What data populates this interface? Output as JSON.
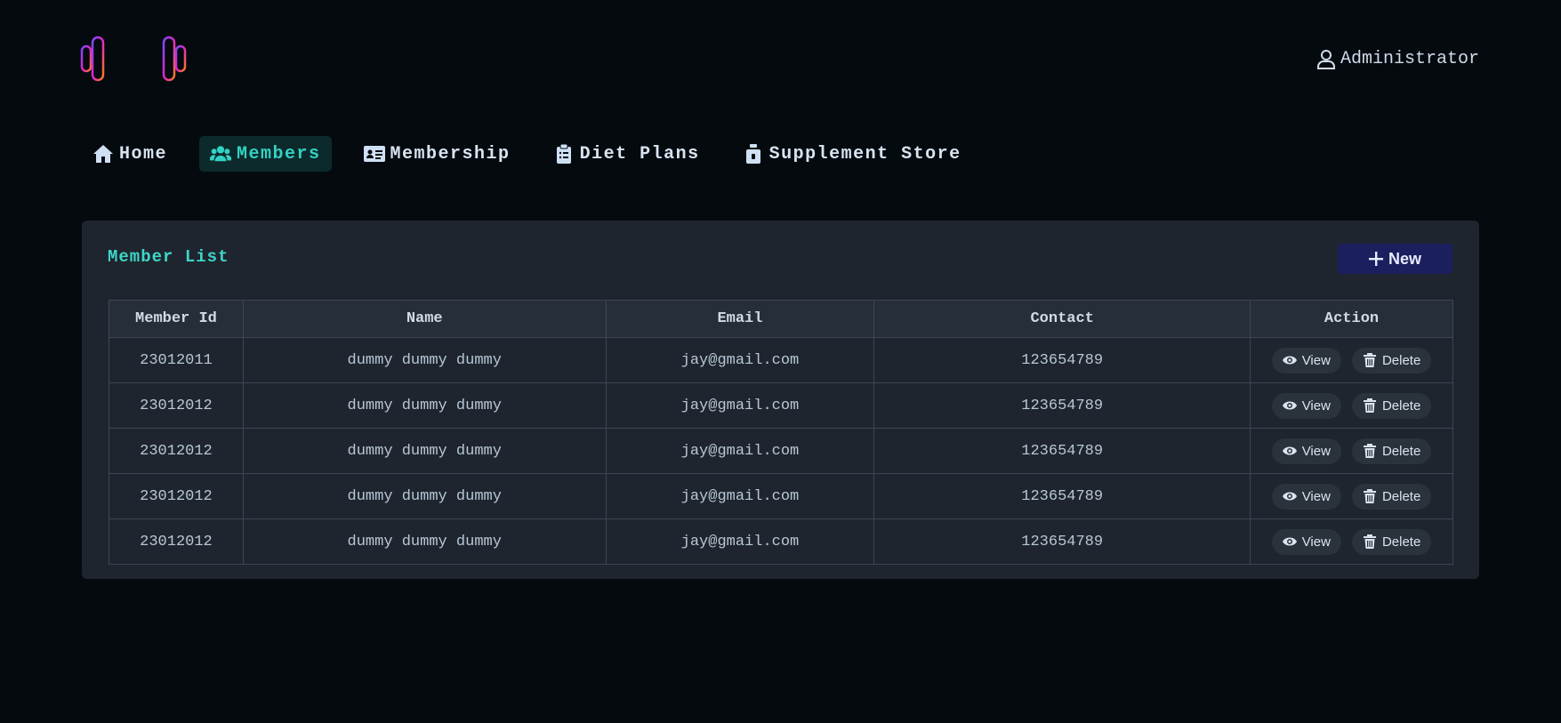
{
  "header": {
    "logo_icon": "dumbbell-icon",
    "user_icon": "user-icon",
    "user_name": "Administrator"
  },
  "nav": {
    "items": [
      {
        "label": "Home",
        "icon": "home-icon",
        "active": false
      },
      {
        "label": "Members",
        "icon": "users-icon",
        "active": true
      },
      {
        "label": "Membership",
        "icon": "id-card-icon",
        "active": false
      },
      {
        "label": "Diet Plans",
        "icon": "clipboard-list-icon",
        "active": false
      },
      {
        "label": "Supplement Store",
        "icon": "bottle-icon",
        "active": false
      }
    ]
  },
  "card": {
    "title": "Member List",
    "new_button_label": "New",
    "new_button_icon": "plus-icon"
  },
  "table": {
    "columns": [
      "Member Id",
      "Name",
      "Email",
      "Contact",
      "Action"
    ],
    "rows": [
      {
        "id": "23012011",
        "name": "dummy dummy dummy",
        "email": "jay@gmail.com",
        "contact": "123654789"
      },
      {
        "id": "23012012",
        "name": "dummy dummy dummy",
        "email": "jay@gmail.com",
        "contact": "123654789"
      },
      {
        "id": "23012012",
        "name": "dummy dummy dummy",
        "email": "jay@gmail.com",
        "contact": "123654789"
      },
      {
        "id": "23012012",
        "name": "dummy dummy dummy",
        "email": "jay@gmail.com",
        "contact": "123654789"
      },
      {
        "id": "23012012",
        "name": "dummy dummy dummy",
        "email": "jay@gmail.com",
        "contact": "123654789"
      }
    ],
    "actions": {
      "view_label": "View",
      "view_icon": "eye-icon",
      "delete_label": "Delete",
      "delete_icon": "trash-icon"
    }
  },
  "colors": {
    "background": "#050a0f",
    "card": "#1e252e",
    "accent": "#33d1c4",
    "new_button": "#1b1f5e",
    "logo_gradient": [
      "#e026c8",
      "#ff7a1a",
      "#7a4bff"
    ]
  }
}
